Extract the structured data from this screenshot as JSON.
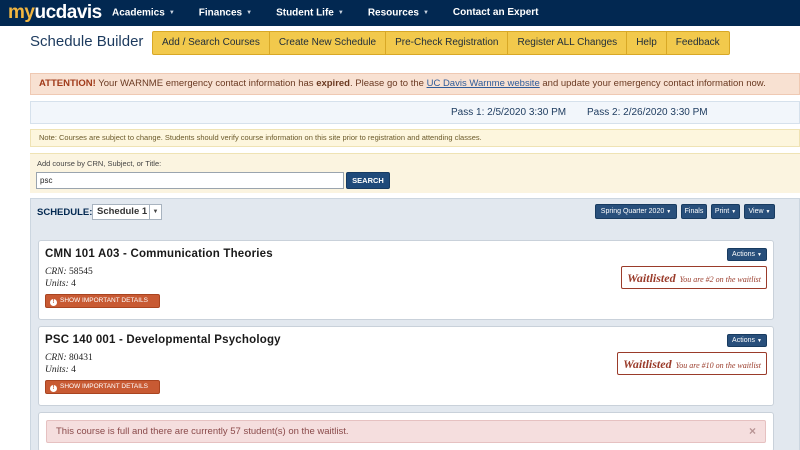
{
  "logo": {
    "my": "my",
    "ucdavis": "ucdavis"
  },
  "nav": {
    "items": [
      {
        "label": "Academics",
        "dropdown": true
      },
      {
        "label": "Finances",
        "dropdown": true
      },
      {
        "label": "Student Life",
        "dropdown": true
      },
      {
        "label": "Resources",
        "dropdown": true
      },
      {
        "label": "Contact an Expert",
        "dropdown": false
      }
    ]
  },
  "page": {
    "title": "Schedule Builder"
  },
  "tabs": [
    "Add / Search Courses",
    "Create New Schedule",
    "Pre-Check Registration",
    "Register ALL Changes",
    "Help",
    "Feedback"
  ],
  "attention": {
    "prefix": "ATTENTION!",
    "text1": " Your WARNME emergency contact information has ",
    "bold": "expired",
    "text2": ". Please go to the ",
    "link": "UC Davis Warnme website",
    "text3": " and update your emergency contact information now."
  },
  "passes": {
    "pass1": "Pass 1: 2/5/2020 3:30 PM",
    "pass2": "Pass 2: 2/26/2020 3:30 PM"
  },
  "note": "Note: Courses are subject to change. Students should verify course information on this site prior to registration and attending classes.",
  "add_course": {
    "label": "Add course by CRN, Subject, or Title:",
    "value": "psc",
    "button": "SEARCH"
  },
  "schedule": {
    "label": "SCHEDULE:",
    "selected": "Schedule 1",
    "quarter": "Spring Quarter 2020",
    "finals": "Finals",
    "print": "Print",
    "view": "View"
  },
  "courses": [
    {
      "title": "CMN 101 A03 - Communication Theories",
      "crn_label": "CRN:",
      "crn": "58545",
      "units_label": "Units:",
      "units": "4",
      "details": "SHOW IMPORTANT DETAILS",
      "actions": "Actions",
      "status": "Waitlisted",
      "position": "You are #2 on the waitlist"
    },
    {
      "title": "PSC 140 001 - Developmental Psychology",
      "crn_label": "CRN:",
      "crn": "80431",
      "units_label": "Units:",
      "units": "4",
      "details": "SHOW IMPORTANT DETAILS",
      "actions": "Actions",
      "status": "Waitlisted",
      "position": "You are #10 on the waitlist"
    }
  ],
  "full_alert": {
    "text": "This course is full and there are currently 57 student(s) on the waitlist.",
    "close": "×"
  }
}
